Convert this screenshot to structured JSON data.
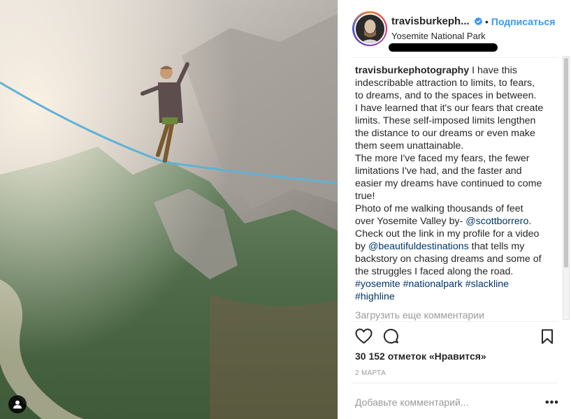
{
  "post": {
    "username": "travisburkeph...",
    "verified_icon": "verified-badge-icon",
    "follow_label": "Подписаться",
    "location": "Yosemite National Park"
  },
  "caption": {
    "author": "travisburkephotography",
    "lines": [
      "I have this",
      "indescribable attraction to limits, to fears,",
      "to dreams, and to the spaces in between.",
      "I have learned that it's our fears that create",
      "limits. These self-imposed limits lengthen",
      "the distance to our dreams or even make",
      "them seem unattainable.",
      "The more I've faced my fears, the fewer",
      "limitations I've had, and the faster and",
      "easier my dreams have continued to come",
      "true!",
      "Photo of me walking thousands of feet",
      "over Yosemite Valley by-"
    ],
    "mention1": "@scottborrero",
    "after_mention1": ".",
    "line_check": "Check out the link in my profile for a video",
    "line_by": "by",
    "mention2": "@beautifuldestinations",
    "after_mention2": "that tells my",
    "lines2": [
      "backstory on chasing dreams and some of",
      "the struggles I faced along the road."
    ],
    "hashtags": [
      "#yosemite",
      "#nationalpark",
      "#slackline",
      "#highline"
    ]
  },
  "load_more_label": "Загрузить еще комментарии",
  "actions": {
    "like_icon": "heart-icon",
    "comment_icon": "comment-icon",
    "save_icon": "bookmark-icon"
  },
  "likes_text": "30 152 отметок «Нравится»",
  "date_text": "2 МАРТА",
  "comment_placeholder": "Добавьте комментарий...",
  "more_label": "•••",
  "colors": {
    "link": "#3897f0",
    "mention": "#003569",
    "muted": "#999999",
    "text": "#262626"
  }
}
